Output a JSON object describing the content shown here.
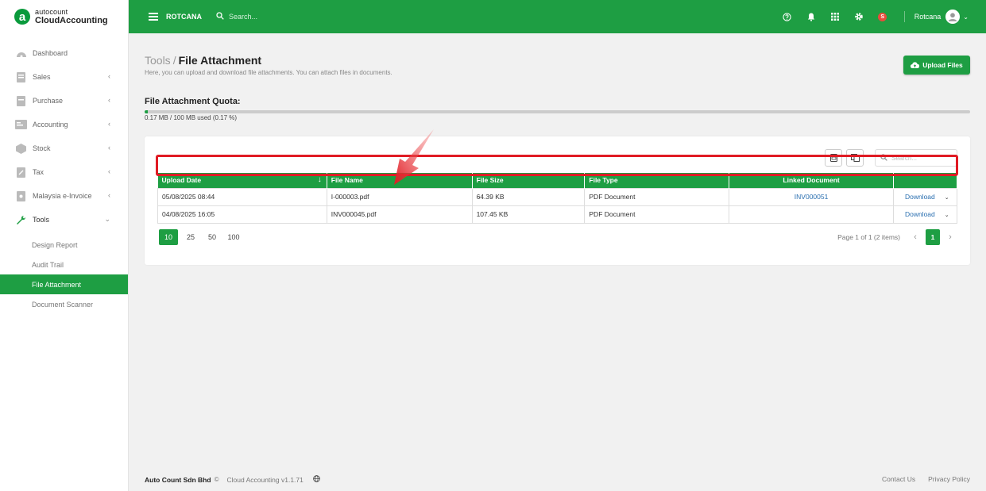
{
  "brand": {
    "line1": "autocount",
    "line2": "CloudAccounting",
    "logo_letter": "a"
  },
  "topbar": {
    "company": "ROTCANA",
    "search_placeholder": "Search...",
    "user_name": "Rotcana",
    "badge": "S",
    "icons": [
      "help-icon",
      "bell-icon",
      "apps-grid-icon",
      "gear-icon"
    ]
  },
  "sidebar": {
    "items": [
      {
        "label": "Dashboard",
        "icon": "dashboard-icon",
        "chevron": ""
      },
      {
        "label": "Sales",
        "icon": "sales-icon",
        "chevron": "‹"
      },
      {
        "label": "Purchase",
        "icon": "purchase-icon",
        "chevron": "‹"
      },
      {
        "label": "Accounting",
        "icon": "accounting-icon",
        "chevron": "‹"
      },
      {
        "label": "Stock",
        "icon": "stock-icon",
        "chevron": "‹"
      },
      {
        "label": "Tax",
        "icon": "tax-icon",
        "chevron": "‹"
      },
      {
        "label": "Malaysia e-Invoice",
        "icon": "einvoice-icon",
        "chevron": "‹"
      },
      {
        "label": "Tools",
        "icon": "wrench-icon",
        "chevron": "⌄"
      }
    ],
    "sub_items": [
      {
        "label": "Design Report"
      },
      {
        "label": "Audit Trail"
      },
      {
        "label": "File Attachment"
      },
      {
        "label": "Document Scanner"
      }
    ]
  },
  "page": {
    "crumb": "Tools",
    "separator": "/",
    "title": "File Attachment",
    "description": "Here, you can upload and download file attachments. You can attach files in documents.",
    "upload_label": "Upload Files"
  },
  "quota": {
    "title": "File Attachment Quota:",
    "text": "0.17 MB / 100 MB used (0.17 %)",
    "used_percent": 0.17
  },
  "grid": {
    "search_placeholder": "Search...",
    "columns": [
      "Upload Date",
      "File Name",
      "File Size",
      "File Type",
      "Linked Document",
      ""
    ],
    "rows": [
      {
        "date": "05/08/2025 08:44",
        "name": "I-000003.pdf",
        "size": "64.39 KB",
        "type": "PDF Document",
        "linked": "INV000051",
        "action": "Download"
      },
      {
        "date": "04/08/2025 16:05",
        "name": "INV000045.pdf",
        "size": "107.45 KB",
        "type": "PDF Document",
        "linked": "",
        "action": "Download"
      }
    ]
  },
  "pager": {
    "sizes": [
      "10",
      "25",
      "50",
      "100"
    ],
    "info": "Page 1 of 1 (2 items)",
    "current": "1"
  },
  "footer": {
    "company": "Auto Count Sdn Bhd",
    "copyright": "©",
    "version": "Cloud Accounting v1.1.71",
    "contact": "Contact Us",
    "privacy": "Privacy Policy"
  },
  "colors": {
    "brand_green": "#1e9e43",
    "highlight_red": "#e01b24",
    "link_blue": "#2a6fb0"
  }
}
